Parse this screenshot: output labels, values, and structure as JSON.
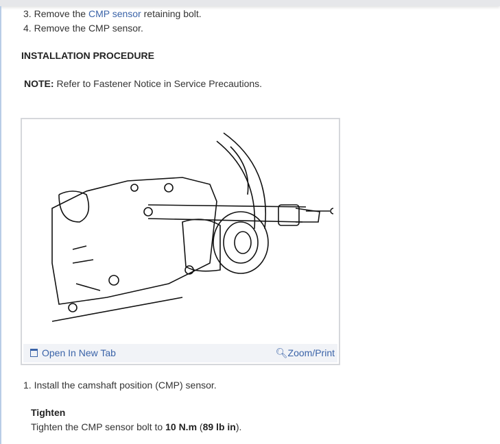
{
  "steps_top": [
    {
      "num": "3.",
      "pre": "Remove the ",
      "link": "CMP sensor",
      "post": " retaining bolt."
    },
    {
      "num": "4.",
      "text": "Remove the CMP sensor."
    }
  ],
  "section_heading": "INSTALLATION PROCEDURE",
  "note": {
    "label": "NOTE:",
    "text": " Refer to Fastener Notice in Service Precautions."
  },
  "figure": {
    "open_new_tab": "Open In New Tab",
    "zoom_print": "Zoom/Print"
  },
  "steps_install": [
    {
      "num": "1.",
      "text": "Install the camshaft position (CMP) sensor."
    }
  ],
  "tighten": {
    "heading": "Tighten",
    "pre": "Tighten the CMP sensor bolt to ",
    "torque_nm": "10 N.m",
    "mid": " (",
    "torque_lb": "89 lb in",
    "post": ")."
  },
  "colors": {
    "link": "#3a63a8",
    "text": "#333333"
  }
}
